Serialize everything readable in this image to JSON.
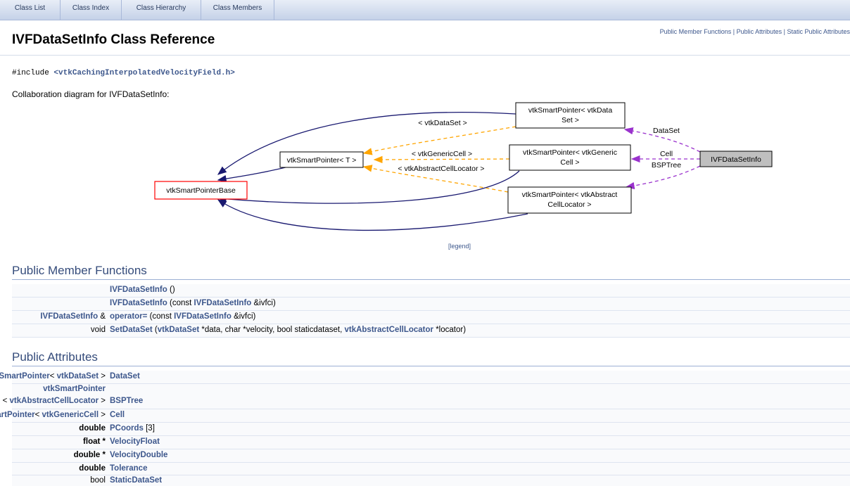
{
  "tabs": [
    "Class List",
    "Class Index",
    "Class Hierarchy",
    "Class Members"
  ],
  "summary_links": {
    "l1": "Public Member Functions",
    "sep1": " | ",
    "l2": "Public Attributes",
    "sep2": " | ",
    "l3": "Static Public Attributes"
  },
  "title": "IVFDataSetInfo Class Reference",
  "include": {
    "prefix": "#include ",
    "file": "<vtkCachingInterpolatedVelocityField.h>"
  },
  "collaboration_label": "Collaboration diagram for IVFDataSetInfo:",
  "diagram": {
    "nodes": {
      "base": "vtkSmartPointerBase",
      "template": "vtkSmartPointer< T >",
      "ds1": "vtkSmartPointer< vtkData",
      "ds2": "Set >",
      "gc1": "vtkSmartPointer< vtkGeneric",
      "gc2": "Cell >",
      "acl1": "vtkSmartPointer< vtkAbstract",
      "acl2": "CellLocator >",
      "info": "IVFDataSetInfo"
    },
    "edge_labels": {
      "t_dataset": "< vtkDataSet >",
      "t_genericcell": "< vtkGenericCell >",
      "t_acl": "< vtkAbstractCellLocator >",
      "m_dataset": "DataSet",
      "m_cell": "Cell",
      "m_bsptree": "BSPTree"
    },
    "colors": {
      "inherit": "#191970",
      "template": "#ffa500",
      "member": "#9a32cd"
    }
  },
  "legend": "[legend]",
  "public_member_functions": {
    "heading": "Public Member Functions",
    "rows": [
      {
        "ret": "",
        "name": "IVFDataSetInfo",
        "args": " ()"
      },
      {
        "ret": "",
        "name": "IVFDataSetInfo",
        "args_pre": " (const ",
        "arg_link": "IVFDataSetInfo",
        "args_post": " &ivfci)"
      },
      {
        "ret_link": "IVFDataSetInfo",
        "ret": " &",
        "name": "operator=",
        "args_pre": " (const ",
        "arg_link": "IVFDataSetInfo",
        "args_post": " &ivfci)"
      },
      {
        "ret": "void",
        "name": "SetDataSet",
        "a1": " (",
        "l1": "vtkDataSet",
        "a2": " *data, char *velocity, bool staticdataset, ",
        "l2": "vtkAbstractCellLocator",
        "a3": " *locator)"
      }
    ]
  },
  "public_attributes": {
    "heading": "Public Attributes",
    "rows": [
      {
        "t1": "vtkSmartPointer",
        "t2": "< ",
        "t3": "vtkDataSet",
        "t4": " >",
        "name": "DataSet"
      },
      {
        "t1": "vtkSmartPointer",
        "t2": "< ",
        "t3": "vtkAbstractCellLocator",
        "t4": " >",
        "name": "BSPTree"
      },
      {
        "t1": "vtkSmartPointer",
        "t2": "< ",
        "t3": "vtkGenericCell",
        "t4": " >",
        "name": "Cell"
      },
      {
        "type": "double",
        "name": "PCoords",
        "suffix": " [3]"
      },
      {
        "type": "float *",
        "name": "VelocityFloat"
      },
      {
        "type": "double *",
        "name": "VelocityDouble"
      },
      {
        "type": "double",
        "name": "Tolerance"
      },
      {
        "type": "bool",
        "name": "StaticDataSet"
      }
    ]
  }
}
